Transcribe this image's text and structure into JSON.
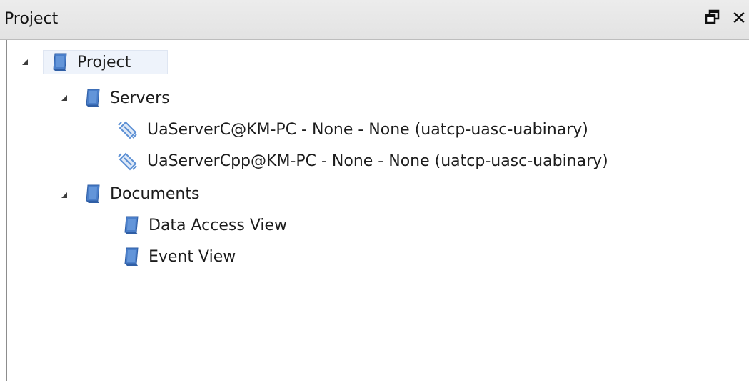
{
  "panel": {
    "title": "Project",
    "float_icon": "float-window-icon",
    "close_icon": "close-icon"
  },
  "tree": {
    "root": {
      "label": "Project",
      "icon": "folder-icon",
      "expanded": true
    },
    "servers": {
      "label": "Servers",
      "icon": "folder-icon",
      "expanded": true,
      "items": [
        {
          "label": "UaServerC@KM-PC - None - None (uatcp-uasc-uabinary)",
          "icon": "server-connection-icon"
        },
        {
          "label": "UaServerCpp@KM-PC - None - None (uatcp-uasc-uabinary)",
          "icon": "server-connection-icon"
        }
      ]
    },
    "documents": {
      "label": "Documents",
      "icon": "folder-icon",
      "expanded": true,
      "items": [
        {
          "label": "Data Access View",
          "icon": "folder-icon"
        },
        {
          "label": "Event View",
          "icon": "folder-icon"
        }
      ]
    }
  },
  "colors": {
    "titlebar_bg": "#e6e6e6",
    "folder_blue": "#4a7ec9",
    "plug_blue": "#5b8fd4"
  }
}
